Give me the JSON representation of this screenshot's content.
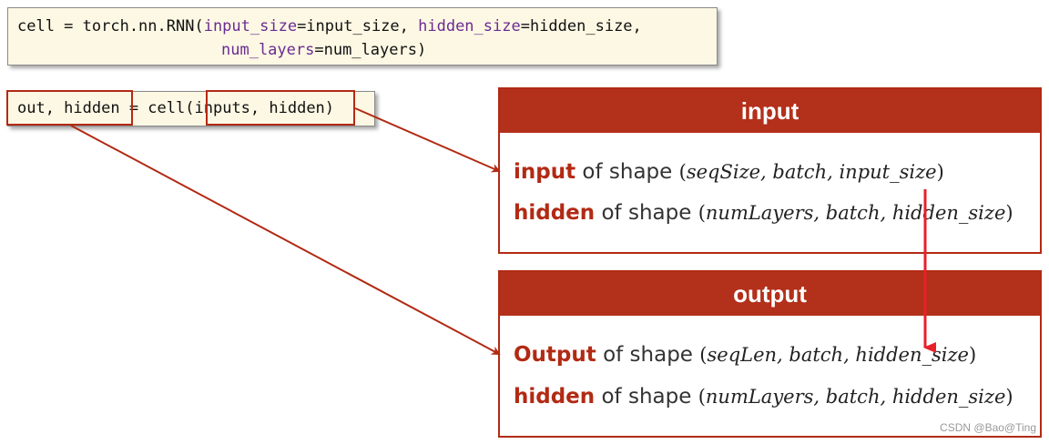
{
  "code": {
    "line1": {
      "p1": "cell = torch.nn.RNN(",
      "k1": "input_size",
      "p2": "=input_size, ",
      "k2": "hidden_size",
      "p3": "=hidden_size,"
    },
    "line2": {
      "k1": "num_layers",
      "p1": "=num_layers)"
    },
    "call": {
      "lhs": "out, hidden",
      "mid": " = cell",
      "open": "(",
      "args": "inputs, hidden",
      "close": ")"
    }
  },
  "input_panel": {
    "title": "input",
    "rows": [
      {
        "key": "input",
        "text": " of shape ",
        "open": "(",
        "math": "seqSize, batch, input_size",
        "close": ")"
      },
      {
        "key": "hidden",
        "text": " of shape ",
        "open": "(",
        "math": "numLayers, batch, hidden_size",
        "close": ")"
      }
    ]
  },
  "output_panel": {
    "title": "output",
    "rows": [
      {
        "key": "Output",
        "text": " of shape ",
        "open": "(",
        "math": "seqLen, batch, hidden_size",
        "close": ")"
      },
      {
        "key": "hidden",
        "text": " of shape ",
        "open": "(",
        "math": "numLayers, batch, hidden_size",
        "close": ")"
      }
    ]
  },
  "watermark": "CSDN @Bao@Ting",
  "colors": {
    "accent": "#b22a14",
    "header": "#b3301a",
    "code_bg": "#fdf8e4",
    "keyword": "#6a2c91",
    "red_arrow": "#e8202a"
  }
}
